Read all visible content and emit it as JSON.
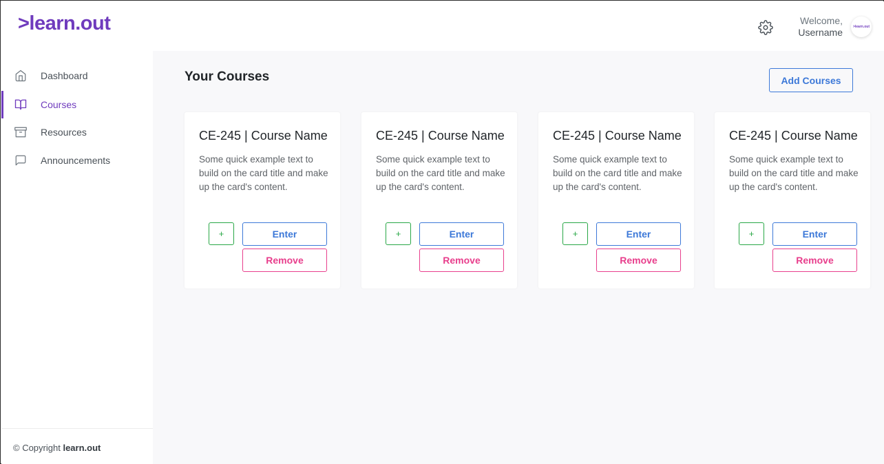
{
  "header": {
    "logo": ">learn.out",
    "welcome": "Welcome,",
    "username": "Username",
    "avatar_text": ">learn.out",
    "settings_icon": "gear-icon"
  },
  "sidebar": {
    "items": [
      {
        "label": "Dashboard",
        "icon": "home-icon",
        "active": false
      },
      {
        "label": "Courses",
        "icon": "book-open-icon",
        "active": true
      },
      {
        "label": "Resources",
        "icon": "archive-icon",
        "active": false
      },
      {
        "label": "Announcements",
        "icon": "message-square-icon",
        "active": false
      }
    ],
    "footer_prefix": "© Copyright",
    "footer_brand": "learn.out"
  },
  "main": {
    "title": "Your Courses",
    "add_button": "Add Courses",
    "cards": [
      {
        "title": "CE-245 | Course Name",
        "text": "Some quick example text to build on the card title and make up the card's content.",
        "plus": "+",
        "enter": "Enter",
        "remove": "Remove"
      },
      {
        "title": "CE-245 | Course Name",
        "text": "Some quick example text to build on the card title and make up the card's content.",
        "plus": "+",
        "enter": "Enter",
        "remove": "Remove"
      },
      {
        "title": "CE-245 | Course Name",
        "text": "Some quick example text to build on the card title and make up the card's content.",
        "plus": "+",
        "enter": "Enter",
        "remove": "Remove"
      },
      {
        "title": "CE-245 | Course Name",
        "text": "Some quick example text to build on the card title and make up the card's content.",
        "plus": "+",
        "enter": "Enter",
        "remove": "Remove"
      }
    ]
  },
  "colors": {
    "brand": "#6f3bbd",
    "primary": "#3c78d8",
    "success": "#28a745",
    "danger": "#e83e8c"
  }
}
